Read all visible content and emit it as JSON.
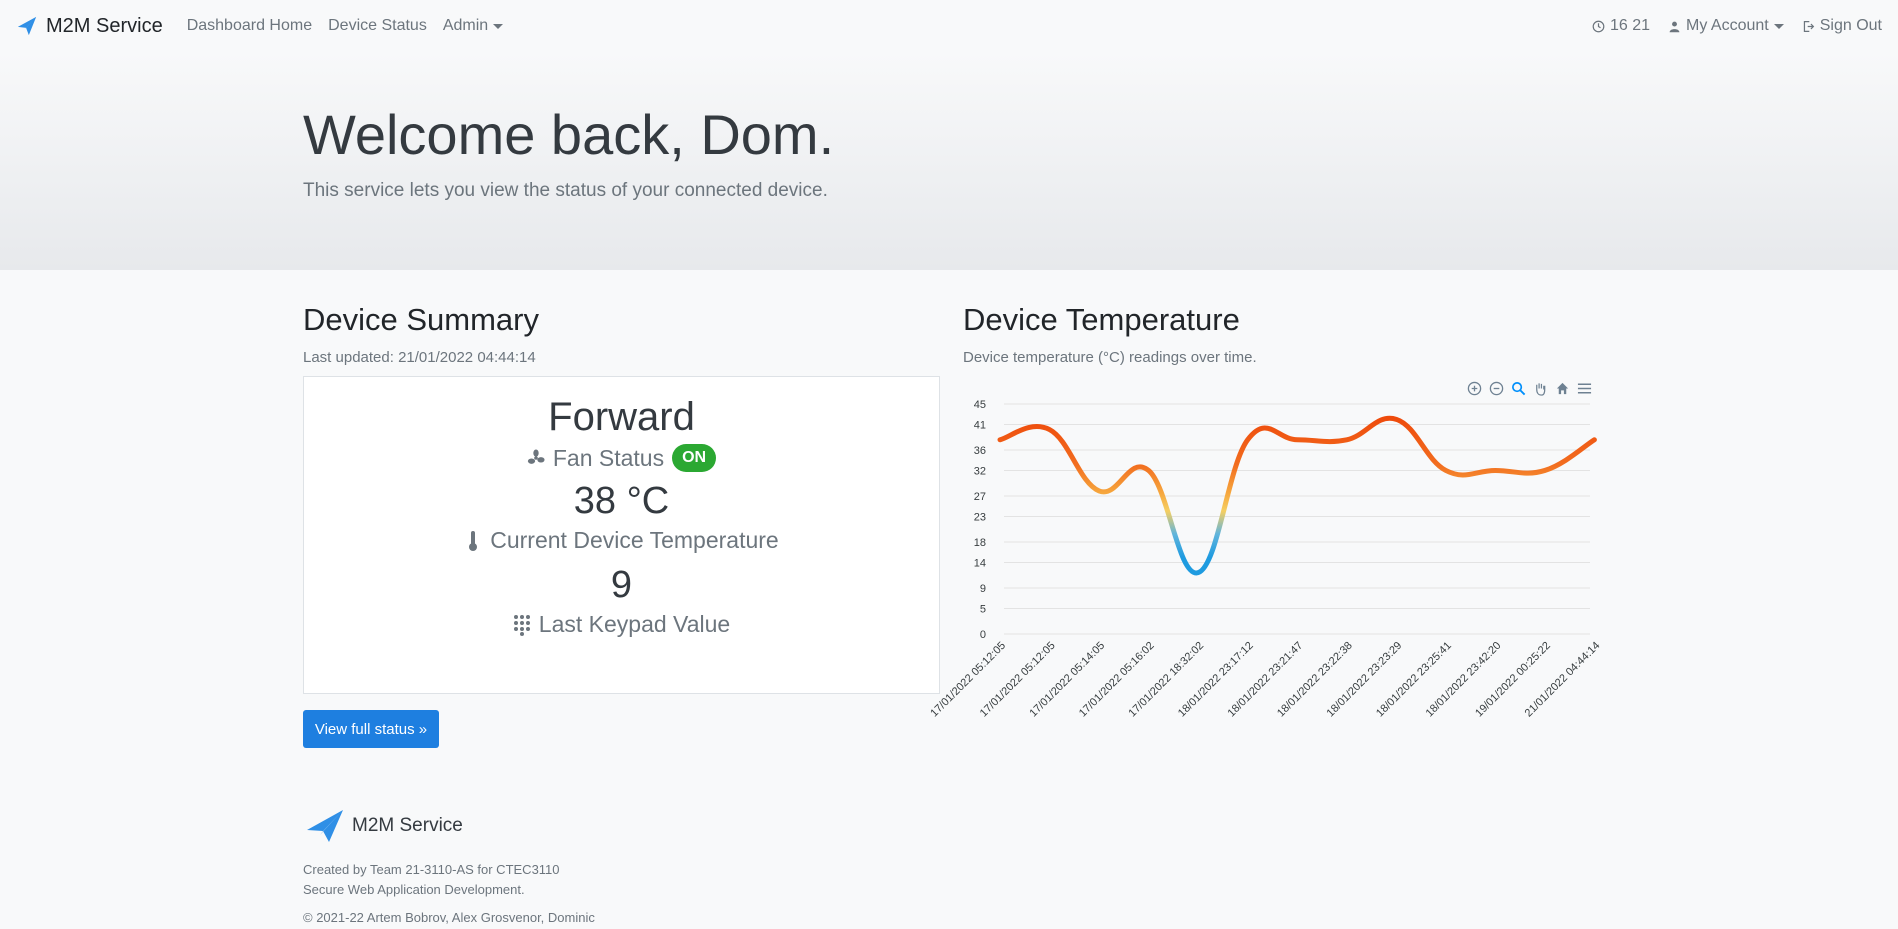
{
  "nav": {
    "brand": "M2M Service",
    "links": [
      "Dashboard Home",
      "Device Status"
    ],
    "admin": "Admin",
    "clock": "16 21",
    "account": "My Account",
    "signout": "Sign Out"
  },
  "hero": {
    "title": "Welcome back, Dom.",
    "subtitle": "This service lets you view the status of your connected device."
  },
  "summary": {
    "title": "Device Summary",
    "updated": "Last updated: 21/01/2022 04:44:14",
    "fan_mode": "Forward",
    "fan_label": "Fan Status",
    "fan_badge": "ON",
    "temperature": "38 °C",
    "temp_label": "Current Device Temperature",
    "keypad": "9",
    "keypad_label": "Last Keypad Value",
    "button": "View full status »"
  },
  "temperature": {
    "title": "Device Temperature",
    "subtitle": "Device temperature (°C) readings over time."
  },
  "toolbar_icons": [
    "zoom-in-icon",
    "zoom-out-icon",
    "selection-zoom-icon",
    "pan-icon",
    "home-icon",
    "menu-icon"
  ],
  "colors": {
    "hot": "#ee4b0c",
    "warm": "#f6a63d",
    "cold": "#1e9be0",
    "primary": "#1e7fe0",
    "badge": "#2ba832"
  },
  "chart_data": {
    "type": "line",
    "x": [
      "17/01/2022 05:12:05",
      "17/01/2022 05:12:05",
      "17/01/2022 05:14:05",
      "17/01/2022 05:16:02",
      "17/01/2022 18:32:02",
      "18/01/2022 23:17:12",
      "18/01/2022 23:21:47",
      "18/01/2022 23:22:38",
      "18/01/2022 23:23:29",
      "18/01/2022 23:25:41",
      "18/01/2022 23:42:20",
      "19/01/2022 00:25:22",
      "21/01/2022 04:44:14"
    ],
    "series": [
      {
        "values": [
          38,
          40,
          28,
          32,
          12,
          38,
          38,
          38,
          42,
          32,
          32,
          32,
          38
        ]
      }
    ],
    "yticks": [
      0,
      5,
      9,
      14,
      18,
      23,
      27,
      32,
      36,
      41,
      45
    ],
    "ylim": [
      0,
      45
    ],
    "grid": true
  },
  "footer": {
    "brand": "M2M Service",
    "credit": "Created by Team 21-3110-AS for CTEC3110 Secure Web Application Development.",
    "copyright": "© 2021-22 Artem Bobrov, Alex Grosvenor, Dominic"
  }
}
